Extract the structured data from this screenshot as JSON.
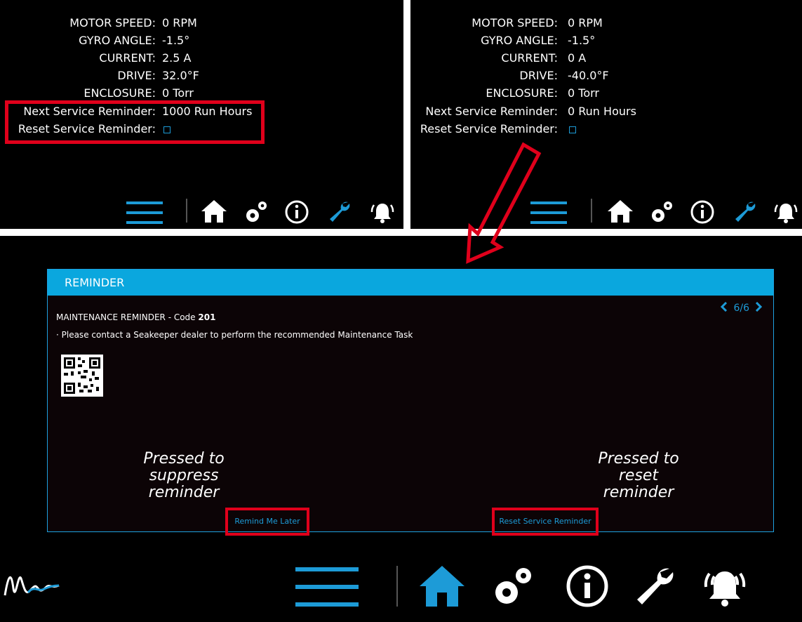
{
  "top_left": {
    "rows": [
      {
        "label": "MOTOR SPEED:",
        "value": "0 RPM"
      },
      {
        "label": "GYRO ANGLE:",
        "value": "-1.5°"
      },
      {
        "label": "CURRENT:",
        "value": "2.5 A"
      },
      {
        "label": "DRIVE:",
        "value": "32.0°F"
      },
      {
        "label": "ENCLOSURE:",
        "value": "0 Torr"
      },
      {
        "label": "Next Service Reminder:",
        "value": "1000 Run Hours"
      },
      {
        "label": "Reset Service Reminder:",
        "value": ""
      }
    ]
  },
  "top_right": {
    "rows": [
      {
        "label": "MOTOR SPEED:",
        "value": "0 RPM"
      },
      {
        "label": "GYRO ANGLE:",
        "value": "-1.5°"
      },
      {
        "label": "CURRENT:",
        "value": "0 A"
      },
      {
        "label": "DRIVE:",
        "value": "-40.0°F"
      },
      {
        "label": "ENCLOSURE:",
        "value": "0 Torr"
      },
      {
        "label": "Next Service Reminder:",
        "value": "0 Run Hours"
      },
      {
        "label": "Reset Service Reminder:",
        "value": ""
      }
    ]
  },
  "reminder": {
    "header": "REMINDER",
    "title_prefix": "MAINTENANCE REMINDER - Code",
    "code": "201",
    "message": "·  Please contact a Seakeeper dealer to perform the recommended Maintenance Task",
    "pager": "6/6",
    "remind_later": "Remind Me Later",
    "reset_reminder": "Reset Service Reminder"
  },
  "annotations": {
    "left": [
      "Pressed to",
      "suppress",
      "reminder"
    ],
    "right": [
      "Pressed to",
      "reset",
      "reminder"
    ]
  },
  "icons": {
    "menu": "menu-icon",
    "home": "home-icon",
    "settings": "gears-icon",
    "info": "info-icon",
    "service": "wrench-icon",
    "alarm": "alarm-bell-icon",
    "logo": "wave-logo-icon"
  },
  "colors": {
    "accent": "#1d9bd7",
    "header": "#0aa7de",
    "highlight": "#e0001b"
  }
}
